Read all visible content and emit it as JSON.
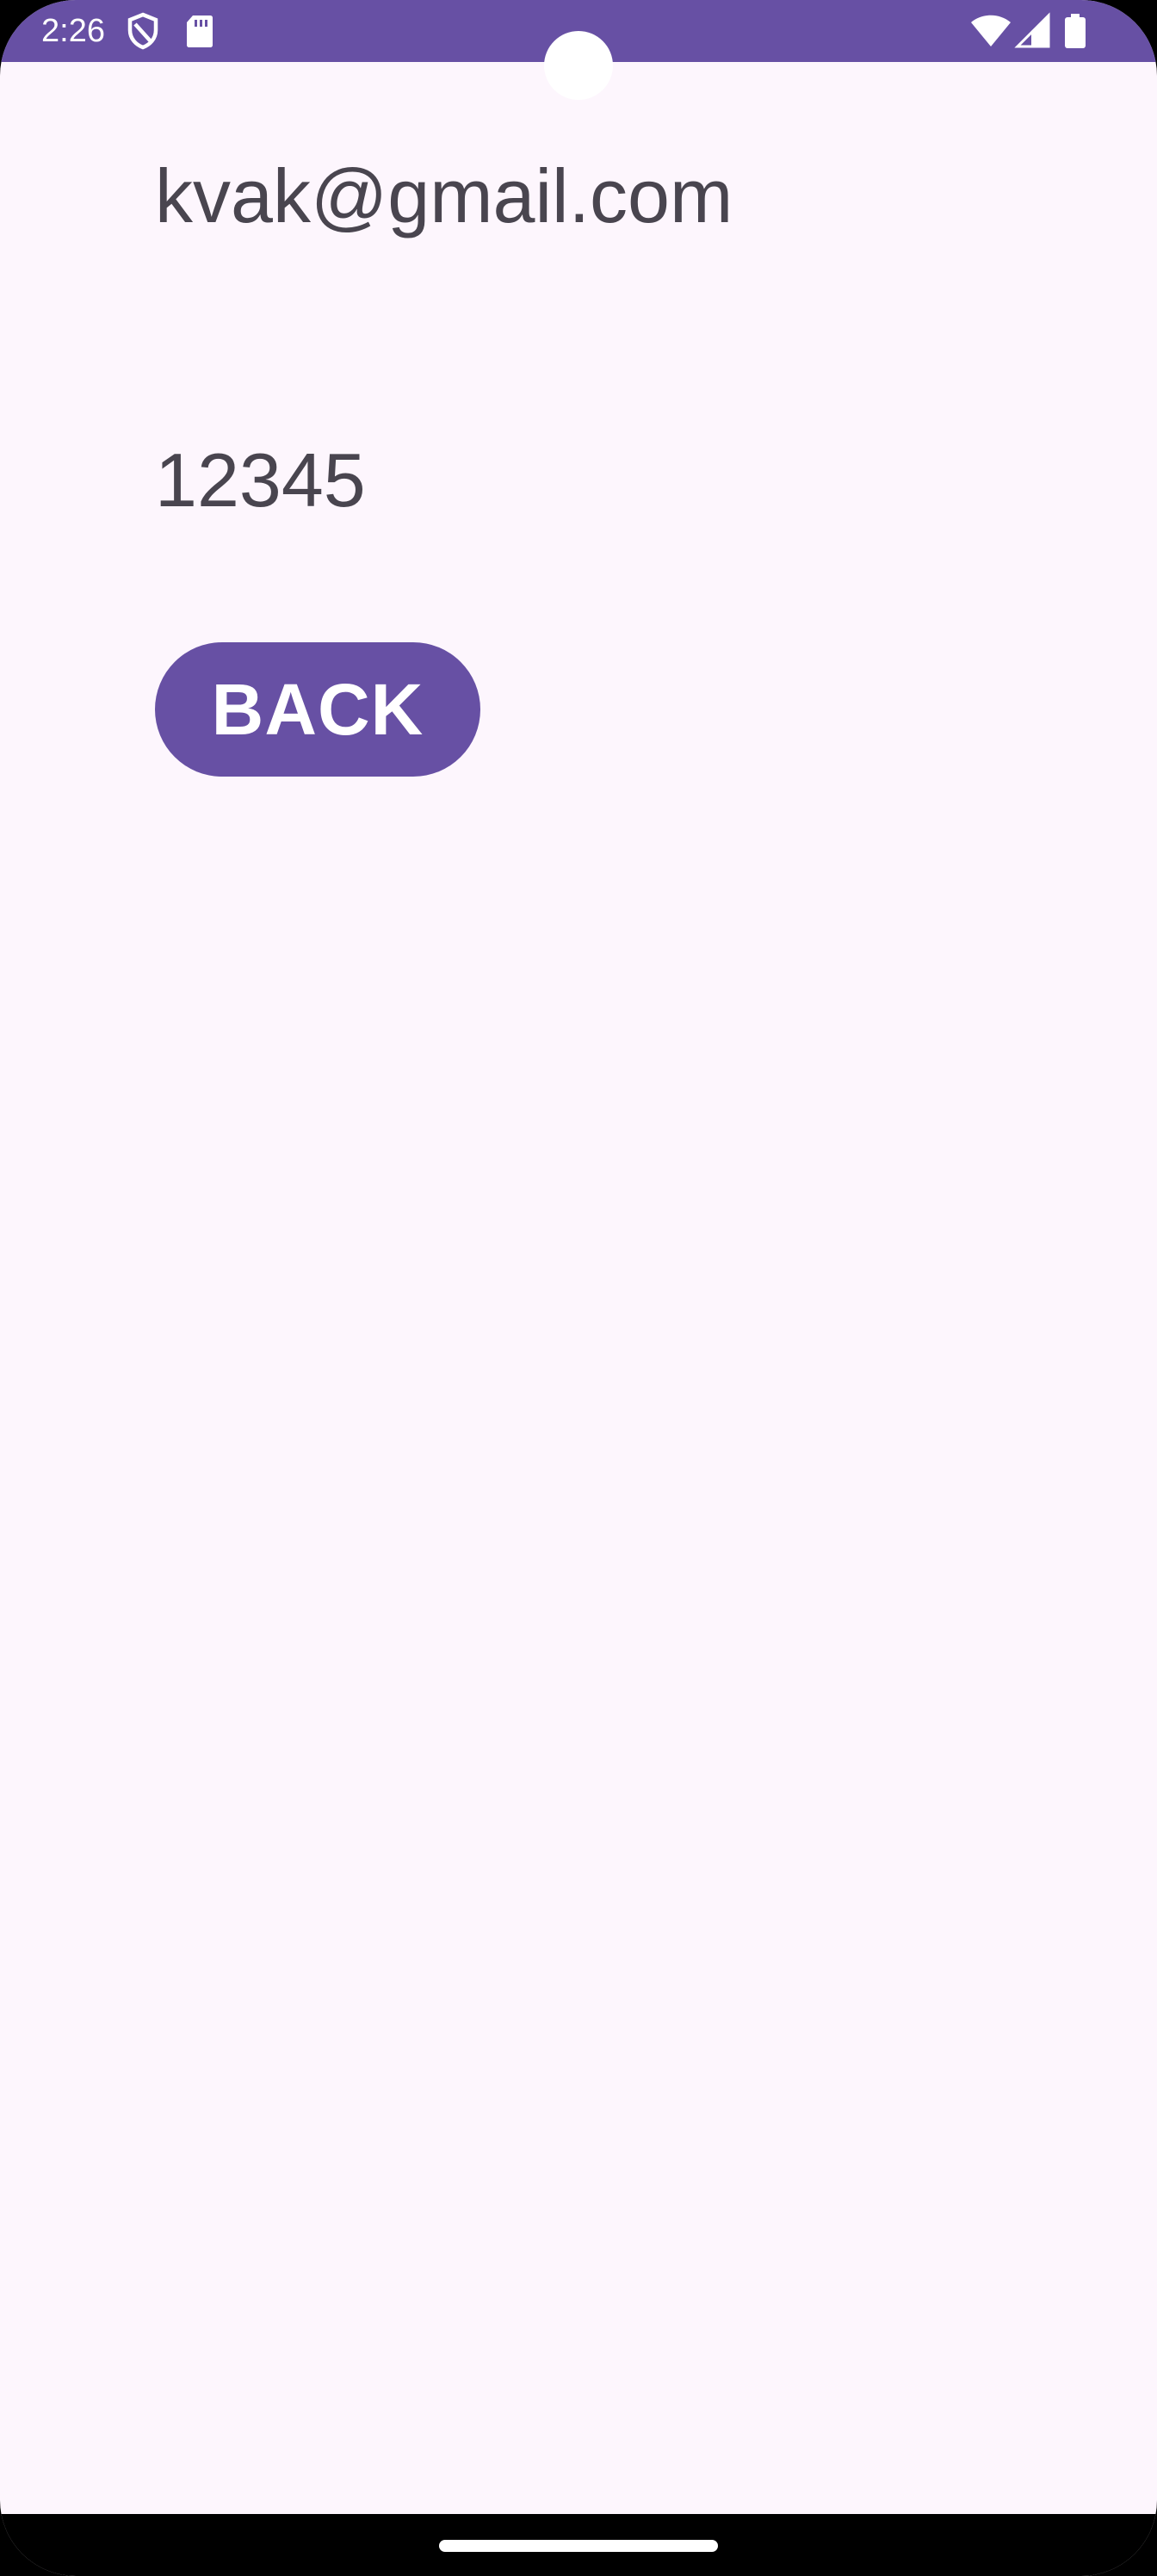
{
  "status_bar": {
    "time": "2:26",
    "background_color": "#6750a4",
    "left_icons": [
      "shield-icon",
      "sd-card-icon"
    ],
    "right_icons": [
      "wifi-icon",
      "cell-signal-icon",
      "battery-icon"
    ]
  },
  "content": {
    "email": "kvak@gmail.com",
    "password": "12345",
    "back_button_label": "BACK"
  },
  "colors": {
    "accent": "#6750a4",
    "background": "#fdf6fd",
    "text": "#49454f"
  }
}
